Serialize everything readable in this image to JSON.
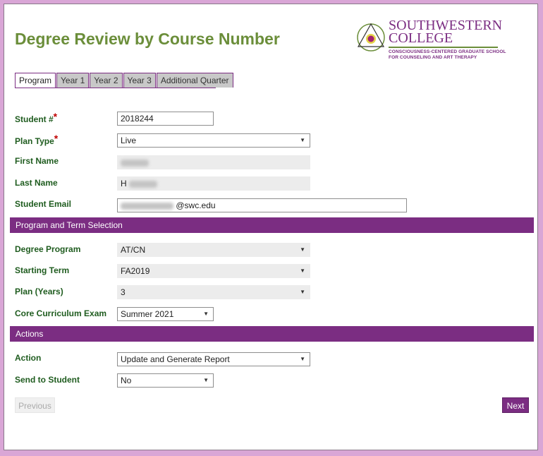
{
  "page": {
    "title": "Degree Review by Course Number"
  },
  "logo": {
    "line1": "SOUTHWESTERN",
    "line2": "COLLEGE",
    "sub1": "CONSCIOUSNESS-CENTERED GRADUATE SCHOOL",
    "sub2": "FOR COUNSELING AND ART THERAPY"
  },
  "tabs": [
    {
      "label": "Program",
      "active": true
    },
    {
      "label": "Year 1"
    },
    {
      "label": "Year 2"
    },
    {
      "label": "Year 3"
    },
    {
      "label": "Additional Quarter"
    }
  ],
  "student": {
    "id_label": "Student #",
    "id_value": "2018244",
    "plan_type_label": "Plan Type",
    "plan_type_value": "Live",
    "first_name_label": "First Name",
    "first_name_value": "",
    "last_name_label": "Last Name",
    "last_name_value": "H",
    "email_label": "Student Email",
    "email_value": "@swc.edu"
  },
  "program_section": {
    "header": "Program and Term Selection",
    "degree_label": "Degree Program",
    "degree_value": "AT/CN",
    "term_label": "Starting Term",
    "term_value": "FA2019",
    "plan_years_label": "Plan (Years)",
    "plan_years_value": "3",
    "exam_label": "Core Curriculum Exam",
    "exam_value": "Summer 2021"
  },
  "actions_section": {
    "header": "Actions",
    "action_label": "Action",
    "action_value": "Update and Generate Report",
    "send_label": "Send to Student",
    "send_value": "No"
  },
  "buttons": {
    "previous": "Previous",
    "next": "Next"
  },
  "required_mark": "*",
  "caret": "▼",
  "colors": {
    "brand": "#7b2d82",
    "title": "#6b8e3a",
    "label": "#1f5c1f"
  }
}
